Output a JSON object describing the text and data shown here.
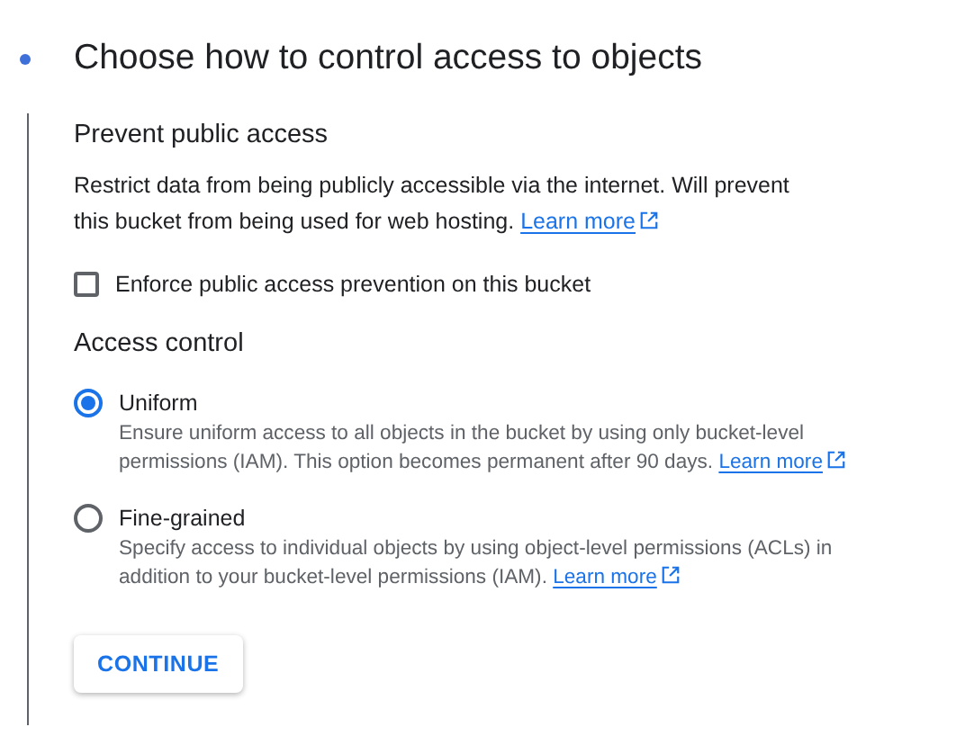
{
  "step": {
    "title": "Choose how to control access to objects",
    "active": true
  },
  "prevent_public_access": {
    "heading": "Prevent public access",
    "description": "Restrict data from being publicly accessible via the internet. Will prevent this bucket from being used for web hosting.",
    "link": "Learn more",
    "checkbox": {
      "label": "Enforce public access prevention on this bucket",
      "checked": false
    }
  },
  "access_control": {
    "heading": "Access control",
    "options": [
      {
        "label": "Uniform",
        "description": "Ensure uniform access to all objects in the bucket by using only bucket-level permissions (IAM). This option becomes permanent after 90 days.",
        "link": "Learn more",
        "selected": true
      },
      {
        "label": "Fine-grained",
        "description": "Specify access to individual objects by using object-level permissions (ACLs) in addition to your bucket-level permissions (IAM).",
        "link": "Learn more",
        "selected": false
      }
    ]
  },
  "button": "CONTINUE"
}
